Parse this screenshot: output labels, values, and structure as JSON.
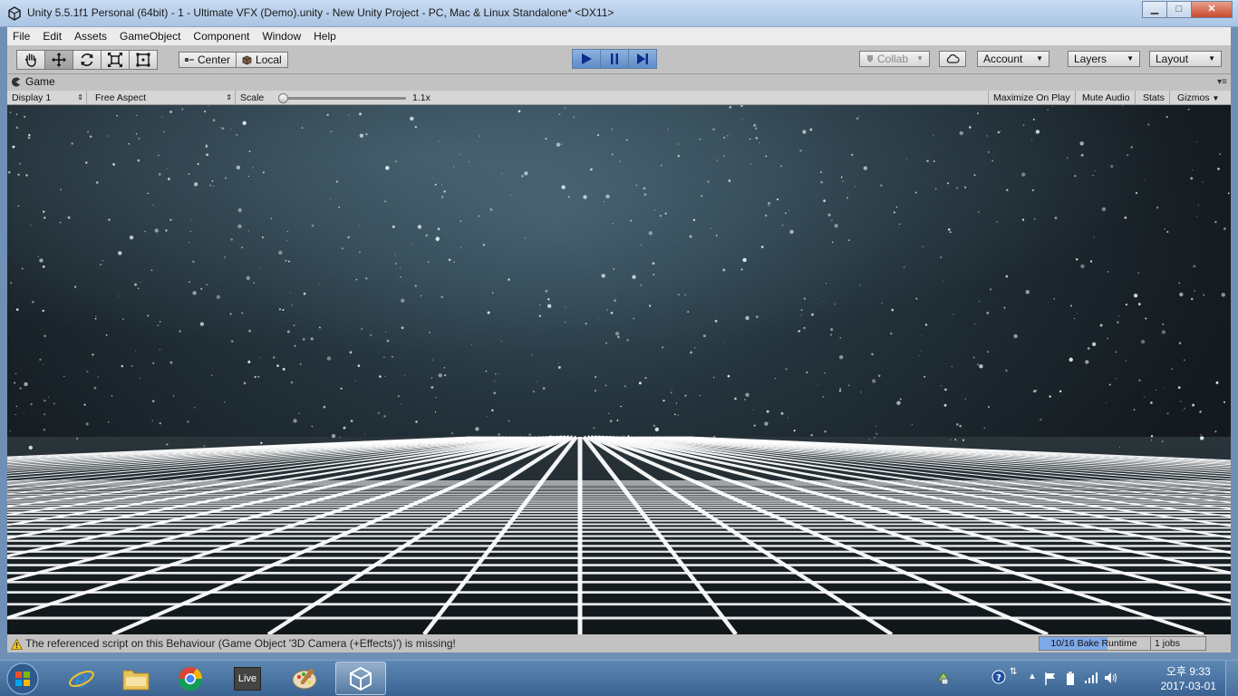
{
  "window": {
    "title": "Unity 5.5.1f1 Personal (64bit) - 1 - Ultimate VFX (Demo).unity - New Unity Project - PC, Mac & Linux Standalone* <DX11>",
    "minimize": "▁",
    "maximize": "□",
    "close": "✕"
  },
  "menu": [
    "File",
    "Edit",
    "Assets",
    "GameObject",
    "Component",
    "Window",
    "Help"
  ],
  "toolbar": {
    "tools": [
      "hand-tool",
      "move-tool",
      "rotate-tool",
      "scale-tool",
      "rect-tool"
    ],
    "pivot_label": "Center",
    "space_label": "Local",
    "collab_label": "Collab",
    "account_label": "Account",
    "layers_label": "Layers",
    "layout_label": "Layout"
  },
  "game_view": {
    "tab_label": "Game",
    "display": "Display 1",
    "aspect": "Free Aspect",
    "scale_label": "Scale",
    "scale_value": "1.1x",
    "maximize_on_play": "Maximize On Play",
    "mute_audio": "Mute Audio",
    "stats": "Stats",
    "gizmos": "Gizmos"
  },
  "status": {
    "message": "The referenced script on this Behaviour (Game Object '3D Camera (+Effects)') is missing!",
    "bake_text": "10/16 Bake Runtime",
    "bake_progress": 0.625,
    "jobs_text": "1 jobs"
  },
  "taskbar": {
    "apps": [
      "internet-explorer",
      "file-explorer",
      "chrome",
      "live",
      "paint",
      "unity"
    ],
    "live_label": "Live",
    "time": "오후 9:33",
    "date": "2017-03-01"
  },
  "colors": {
    "play_blue": "#5d8cc8",
    "editor_gray": "#c2c2c2",
    "taskbar_blue": "#3a6392"
  }
}
